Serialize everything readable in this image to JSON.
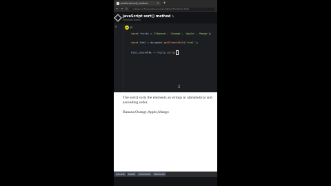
{
  "browser": {
    "tab_title": "JavaScript sort() method",
    "new_tab_glyph": "+",
    "tab_close_glyph": "×",
    "url": "codepen.io/fernandobueno/pen/OJKGaYP?editors=0011"
  },
  "codepen": {
    "pen_title": "JavaScript sort() method",
    "author": "Fernando Bueno",
    "language_label": "JS",
    "language_icon": "js-icon"
  },
  "code": {
    "line1": {
      "kw": "const ",
      "id": "fruits",
      "op": " = [",
      "s1": "'Banana'",
      "c1": ", ",
      "s2": "'Orange'",
      "c2": ", ",
      "s3": "'Apple'",
      "c3": ", ",
      "s4": "'Mango'",
      "end": "];"
    },
    "line2": {
      "kw": "const ",
      "id": "html",
      "op": " = ",
      "obj": "document",
      "dot": ".",
      "fn": "getElementById",
      "open": "(",
      "s": "'html'",
      "end": ");"
    },
    "line3": {
      "id": "html",
      "dot": ".",
      "prop": "innerHTML",
      "op": " = ",
      "obj": "fruits",
      "dot2": ".",
      "fn": "sort",
      "end": "()"
    },
    "ibeam": "I"
  },
  "result": {
    "description": "The sort() sorts the elements as strings in alphabetical and ascending order.",
    "output": "Banana,Orange,Apple,Mango"
  },
  "bottom_tabs": [
    "Console",
    "Assets",
    "Comments",
    "Shortcuts"
  ]
}
